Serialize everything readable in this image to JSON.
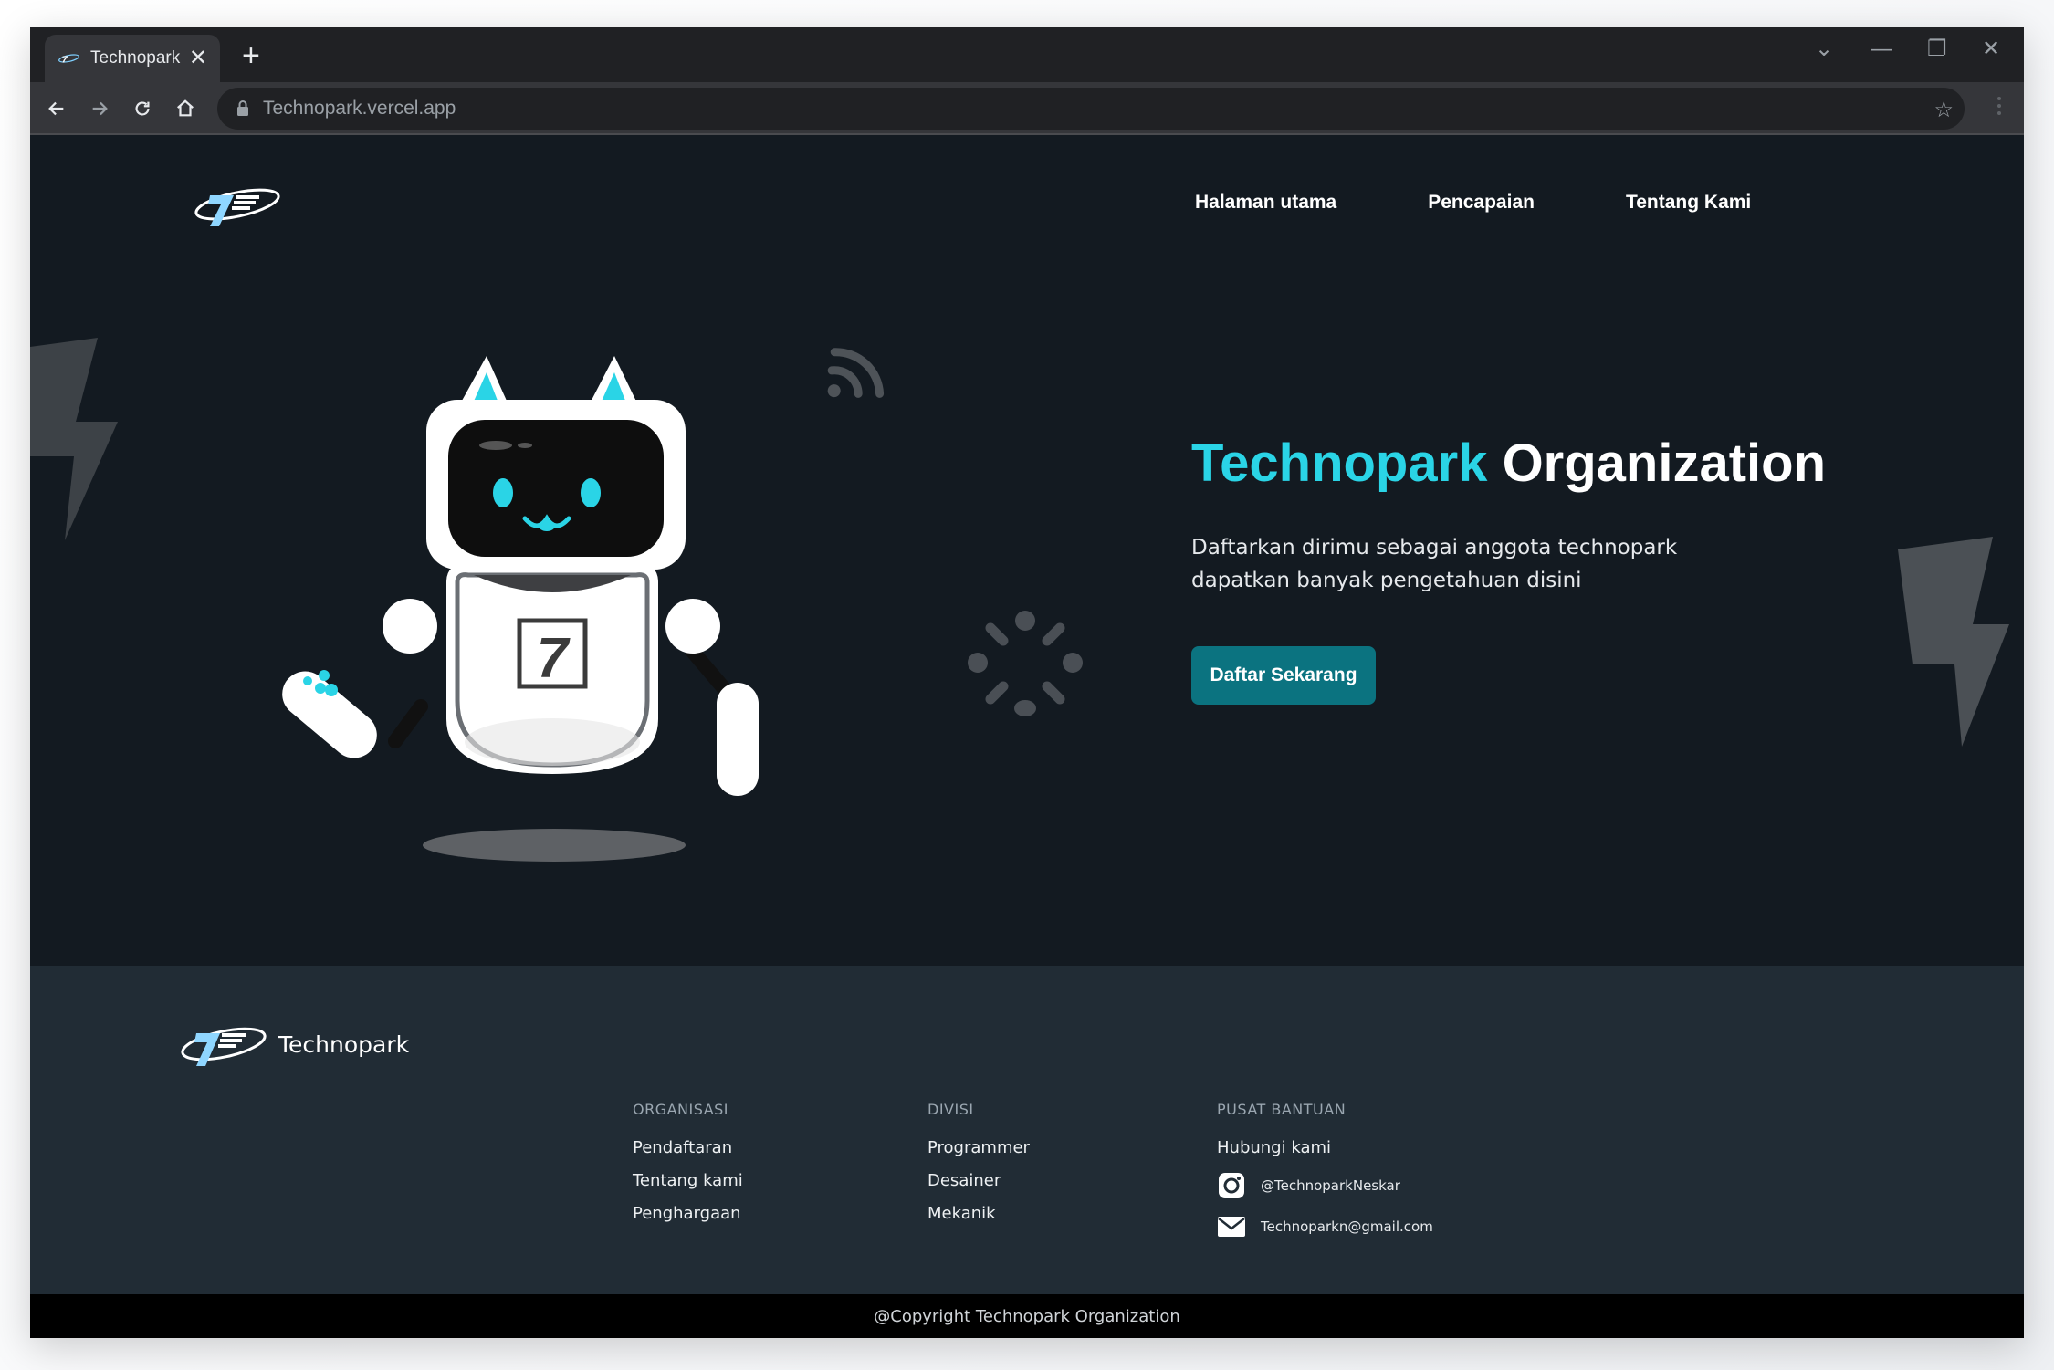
{
  "browser": {
    "tab_title": "Technopark",
    "tab_close": "✕",
    "new_tab": "+",
    "url": "Technopark.vercel.app",
    "bookmark_star": "☆",
    "controls": {
      "dropdown": "⌄",
      "minimize": "—",
      "restore": "❐",
      "close": "✕"
    }
  },
  "nav": {
    "items": [
      {
        "label": "Halaman utama"
      },
      {
        "label": "Pencapaian"
      },
      {
        "label": "Tentang Kami"
      }
    ]
  },
  "hero": {
    "title_accent": "Technopark",
    "title_rest": "Organization",
    "subtitle": "Daftarkan dirimu sebagai anggota technopark dapatkan banyak  pengetahuan disini",
    "cta_label": "Daftar Sekarang",
    "robot_badge": "7"
  },
  "footer": {
    "brand": "Technopark",
    "columns": [
      {
        "heading": "ORGANISASI",
        "links": [
          "Pendaftaran",
          "Tentang kami",
          "Penghargaan"
        ]
      },
      {
        "heading": "DIVISI",
        "links": [
          "Programmer",
          "Desainer",
          "Mekanik"
        ]
      }
    ],
    "help": {
      "heading": "PUSAT BANTUAN",
      "contact_link": "Hubungi kami",
      "instagram": "@TechnoparkNeskar",
      "email": "Technoparkn@gmail.com"
    },
    "copyright": "@Copyright Technopark Organization"
  },
  "colors": {
    "accent": "#2ad4e6",
    "cta": "#0b7380",
    "hero_bg": "#131a21",
    "footer_bg": "#212c35"
  },
  "icons": [
    "back-icon",
    "forward-icon",
    "reload-icon",
    "home-icon",
    "lock-icon",
    "star-icon",
    "kebab-icon",
    "lightning-icon",
    "wifi-icon",
    "spinner-icon",
    "instagram-icon",
    "mail-icon"
  ]
}
